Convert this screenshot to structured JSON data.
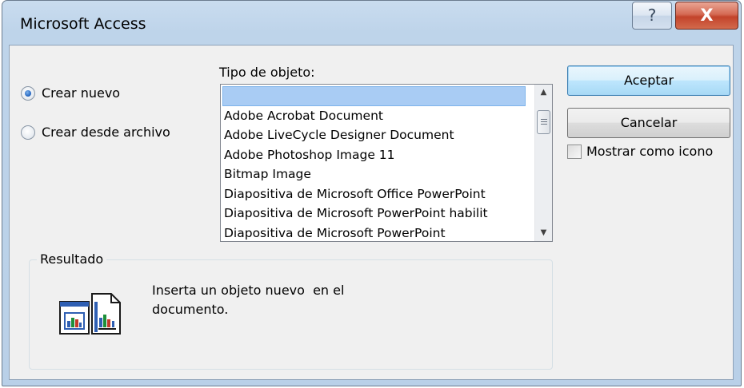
{
  "window": {
    "title": "Microsoft Access",
    "help_glyph": "?",
    "close_glyph": "X"
  },
  "create_options": [
    {
      "label": "Crear nuevo",
      "checked": true
    },
    {
      "label": "Crear desde archivo",
      "checked": false
    }
  ],
  "object_type": {
    "label": "Tipo de objeto:",
    "items": [
      "",
      "Adobe Acrobat Document",
      "Adobe LiveCycle Designer Document",
      "Adobe Photoshop Image 11",
      "Bitmap Image",
      "Diapositiva de Microsoft Office PowerPoint",
      "Diapositiva de Microsoft PowerPoint habilit",
      "Diapositiva de Microsoft PowerPoint"
    ],
    "selected_index": 0
  },
  "buttons": {
    "ok": "Aceptar",
    "cancel": "Cancelar"
  },
  "display_as_icon": {
    "label": "Mostrar como icono",
    "checked": false
  },
  "result": {
    "label": "Resultado",
    "line1": "Inserta un objeto nuevo  en el",
    "line2": "documento."
  },
  "icons": [
    "help-icon",
    "close-icon",
    "scroll-up-icon",
    "scroll-down-icon",
    "embedded-object-icon"
  ],
  "colors": {
    "selection": "#a9ccf4",
    "default_button_border": "#3c7fb1",
    "close_red": "#c3432b"
  }
}
